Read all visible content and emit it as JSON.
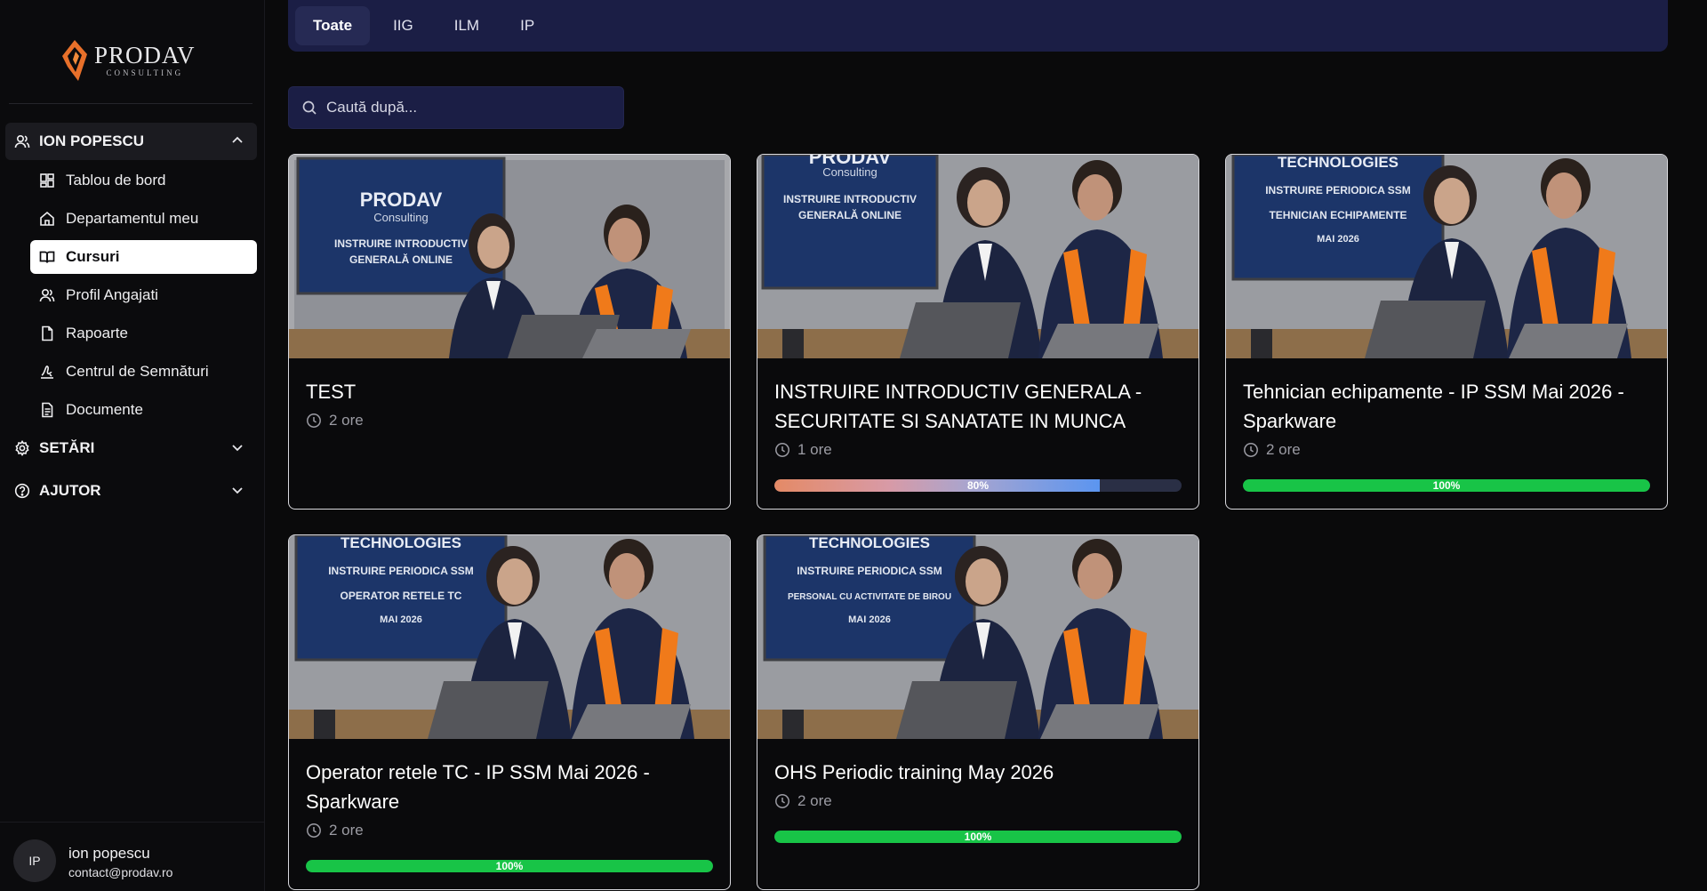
{
  "brand": {
    "name": "PRODAV",
    "sub": "CONSULTING",
    "accent": "#e8702a"
  },
  "sidebar": {
    "user_group": "ION POPESCU",
    "items": [
      {
        "label": "Tablou de bord",
        "icon": "dashboard-icon"
      },
      {
        "label": "Departamentul meu",
        "icon": "home-icon"
      },
      {
        "label": "Cursuri",
        "icon": "book-icon",
        "selected": true
      },
      {
        "label": "Profil Angajati",
        "icon": "users-icon"
      },
      {
        "label": "Rapoarte",
        "icon": "file-icon"
      },
      {
        "label": "Centrul de Semnături",
        "icon": "signature-icon"
      },
      {
        "label": "Documente",
        "icon": "document-icon"
      }
    ],
    "settings": "SETĂRI",
    "help": "AJUTOR"
  },
  "user": {
    "initials": "IP",
    "name": "ion popescu",
    "email": "contact@prodav.ro"
  },
  "tabs": [
    {
      "label": "Toate",
      "active": true
    },
    {
      "label": "IIG"
    },
    {
      "label": "ILM"
    },
    {
      "label": "IP"
    }
  ],
  "search": {
    "placeholder": "Caută după..."
  },
  "courses": [
    {
      "title": "TEST",
      "duration": "2 ore",
      "progress": null,
      "thumb": {
        "brand": "PRODAV",
        "brand_sub": "Consulting",
        "lines": [
          "INSTRUIRE INTRODUCTIV",
          "GENERALĂ ONLINE"
        ]
      }
    },
    {
      "title": "INSTRUIRE INTRODUCTIV GENERALA - SECURITATE SI SANATATE IN MUNCA",
      "duration": "1 ore",
      "progress": 80,
      "progress_label": "80%",
      "thumb": {
        "brand": "PRODAV",
        "brand_sub": "Consulting",
        "lines": [
          "INSTRUIRE INTRODUCTIV",
          "GENERALĂ ONLINE"
        ]
      }
    },
    {
      "title": "Tehnician echipamente - IP SSM Mai 2026 - Sparkware",
      "duration": "2 ore",
      "progress": 100,
      "progress_label": "100%",
      "thumb": {
        "brand": "TECHNOLOGIES",
        "brand_sub": "",
        "lines": [
          "INSTRUIRE PERIODICA SSM",
          "TEHNICIAN ECHIPAMENTE",
          "MAI 2026"
        ]
      }
    },
    {
      "title": "Operator retele TC - IP SSM Mai 2026 - Sparkware",
      "duration": "2 ore",
      "progress": 100,
      "progress_label": "100%",
      "thumb": {
        "brand": "TECHNOLOGIES",
        "brand_sub": "",
        "lines": [
          "INSTRUIRE PERIODICA SSM",
          "OPERATOR RETELE TC",
          "MAI 2026"
        ]
      }
    },
    {
      "title": "OHS Periodic training May 2026",
      "duration": "2 ore",
      "progress": 100,
      "progress_label": "100%",
      "thumb": {
        "brand": "TECHNOLOGIES",
        "brand_sub": "",
        "lines": [
          "INSTRUIRE PERIODICA SSM",
          "PERSONAL CU ACTIVITATE DE BIROU",
          "MAI 2026"
        ]
      }
    }
  ]
}
